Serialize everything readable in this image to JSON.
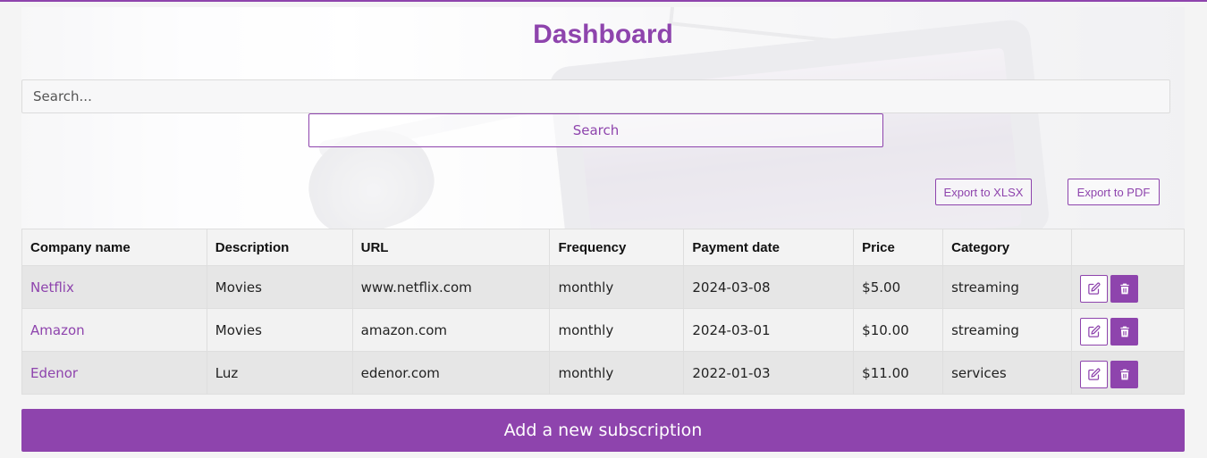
{
  "page": {
    "title": "Dashboard",
    "accent_color": "#8e44ad"
  },
  "search": {
    "placeholder": "Search...",
    "value": "",
    "button_label": "Search"
  },
  "export": {
    "xlsx_label": "Export to XLSX",
    "pdf_label": "Export to PDF"
  },
  "table": {
    "headers": [
      "Company name",
      "Description",
      "URL",
      "Frequency",
      "Payment date",
      "Price",
      "Category",
      ""
    ],
    "rows": [
      {
        "company": "Netflix",
        "description": "Movies",
        "url": "www.netflix.com",
        "frequency": "monthly",
        "payment_date": "2024-03-08",
        "price": "$5.00",
        "category": "streaming"
      },
      {
        "company": "Amazon",
        "description": "Movies",
        "url": "amazon.com",
        "frequency": "monthly",
        "payment_date": "2024-03-01",
        "price": "$10.00",
        "category": "streaming"
      },
      {
        "company": "Edenor",
        "description": "Luz",
        "url": "edenor.com",
        "frequency": "monthly",
        "payment_date": "2022-01-03",
        "price": "$11.00",
        "category": "services"
      }
    ],
    "row_actions": {
      "edit_icon": "edit-icon",
      "delete_icon": "trash-icon"
    }
  },
  "add_button_label": "Add a new subscription"
}
